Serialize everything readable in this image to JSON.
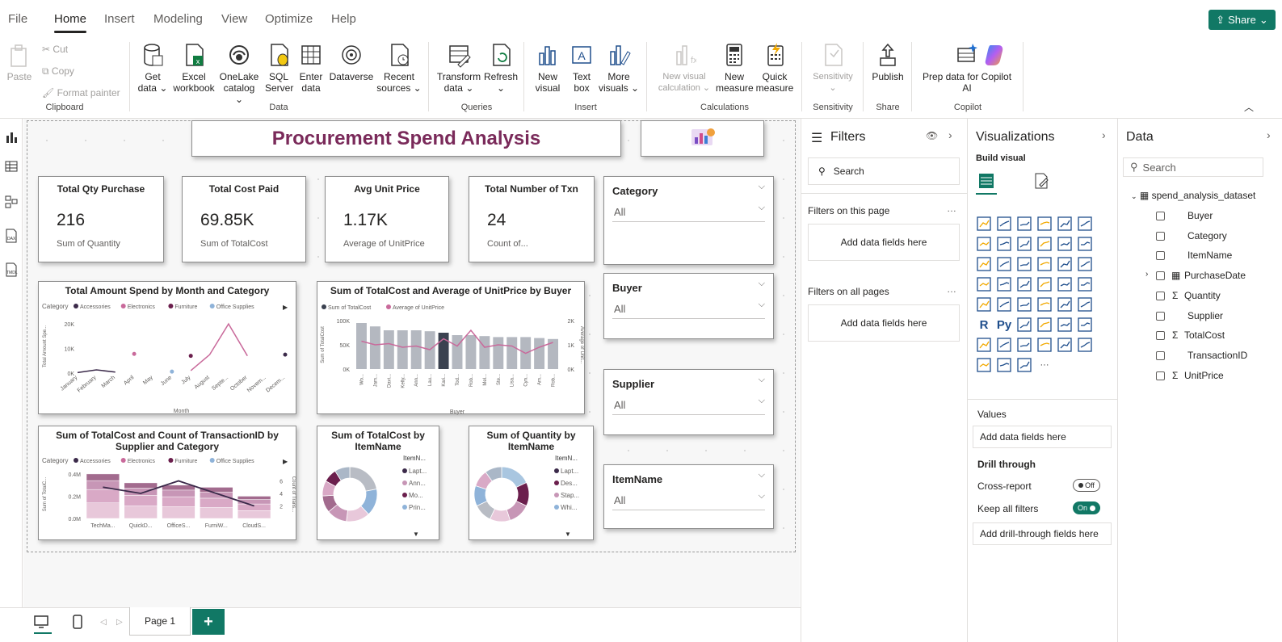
{
  "menu": {
    "file": "File",
    "home": "Home",
    "insert": "Insert",
    "modeling": "Modeling",
    "view": "View",
    "optimize": "Optimize",
    "help": "Help",
    "share": "Share"
  },
  "ribbon": {
    "paste": "Paste",
    "cut": "Cut",
    "copy": "Copy",
    "format_painter": "Format painter",
    "clipboard": "Clipboard",
    "get_data": [
      "Get",
      "data ⌄"
    ],
    "excel": [
      "Excel",
      "workbook"
    ],
    "onelake": [
      "OneLake",
      "catalog ⌄"
    ],
    "sql": [
      "SQL",
      "Server"
    ],
    "enter": [
      "Enter",
      "data"
    ],
    "dataverse": [
      "Dataverse"
    ],
    "recent": [
      "Recent",
      "sources ⌄"
    ],
    "data_group": "Data",
    "transform": [
      "Transform",
      "data ⌄"
    ],
    "refresh": [
      "Refresh",
      "⌄"
    ],
    "queries": "Queries",
    "new_visual": [
      "New",
      "visual"
    ],
    "text_box": [
      "Text",
      "box"
    ],
    "more_visuals": [
      "More",
      "visuals ⌄"
    ],
    "insert_group": "Insert",
    "new_visual_calc": [
      "New visual",
      "calculation ⌄"
    ],
    "new_measure": [
      "New",
      "measure"
    ],
    "quick_measure": [
      "Quick",
      "measure"
    ],
    "calculations": "Calculations",
    "sensitivity": [
      "Sensitivity",
      "⌄"
    ],
    "sensitivity_group": "Sensitivity",
    "publish": [
      "Publish"
    ],
    "share_group": "Share",
    "prep_data": [
      "Prep data for Copilot",
      "AI"
    ],
    "copilot": "Copilot"
  },
  "report": {
    "title": "Procurement Spend Analysis",
    "kpis": [
      {
        "title": "Total Qty Purchase",
        "value": "216",
        "sub": "Sum of Quantity"
      },
      {
        "title": "Total Cost Paid",
        "value": "69.85K",
        "sub": "Sum of TotalCost"
      },
      {
        "title": "Avg Unit Price",
        "value": "1.17K",
        "sub": "Average of UnitPrice"
      },
      {
        "title": "Total Number of Txn",
        "value": "24",
        "sub": "Count of..."
      }
    ],
    "slicers": [
      {
        "title": "Category",
        "value": "All"
      },
      {
        "title": "Buyer",
        "value": "All"
      },
      {
        "title": "Supplier",
        "value": "All"
      },
      {
        "title": "ItemName",
        "value": "All"
      }
    ]
  },
  "chart_data": [
    {
      "type": "line",
      "title": "Total Amount Spend by Month and Category",
      "legend_title": "Category",
      "xlabel": "Month",
      "ylabel": "Total Amount Spe...",
      "categories": [
        "January",
        "February",
        "March",
        "April",
        "May",
        "June",
        "July",
        "August",
        "Septe...",
        "October",
        "Novem...",
        "Decem..."
      ],
      "yticks": [
        "20K",
        "10K",
        "0K"
      ],
      "ylim": [
        0,
        22000
      ],
      "series": [
        {
          "name": "Accessories",
          "color": "#3b2a4a",
          "values": [
            200,
            1300,
            400,
            null,
            null,
            null,
            null,
            null,
            null,
            null,
            null,
            7500
          ]
        },
        {
          "name": "Electronics",
          "color": "#c96a9b",
          "values": [
            null,
            null,
            null,
            7800,
            null,
            null,
            1000,
            7500,
            20000,
            7000,
            null,
            null
          ]
        },
        {
          "name": "Furniture",
          "color": "#6b1f4d",
          "values": [
            null,
            null,
            null,
            null,
            null,
            null,
            7000,
            null,
            null,
            null,
            null,
            null
          ]
        },
        {
          "name": "Office Supplies",
          "color": "#8fb3d9",
          "values": [
            null,
            null,
            null,
            null,
            null,
            600,
            null,
            null,
            null,
            null,
            null,
            null
          ]
        }
      ]
    },
    {
      "type": "bar",
      "title": "Sum of TotalCost and Average of UnitPrice by Buyer",
      "legend": [
        "Sum of TotalCost",
        "Average of UnitPrice"
      ],
      "xlabel": "Buyer",
      "ylabel": "Sum of TotalCost",
      "y2label": "Average of Unit...",
      "categories": [
        "Wo...",
        "Jam...",
        "Davi...",
        "Kelly...",
        "Ann...",
        "Lau...",
        "Kari...",
        "Tod...",
        "Rob...",
        "Mel...",
        "Ste...",
        "Lisa...",
        "Cyn...",
        "Am...",
        "Rob..."
      ],
      "yticks": [
        "100K",
        "50K",
        "0K"
      ],
      "y2ticks": [
        "2K",
        "1K",
        "0K"
      ],
      "ylim": [
        0,
        100000
      ],
      "values": [
        95000,
        88000,
        80000,
        80000,
        80000,
        78000,
        75000,
        70000,
        70000,
        68000,
        66000,
        66000,
        66000,
        64000,
        62000
      ],
      "line_values": [
        1150,
        1000,
        1050,
        900,
        950,
        800,
        1250,
        950,
        1600,
        900,
        1000,
        950,
        650,
        900,
        1100
      ],
      "y2lim": [
        0,
        2000
      ],
      "highlight_index": 6
    },
    {
      "type": "bar",
      "title": "Sum of TotalCost and Count of TransactionID by Supplier and Category",
      "legend_title": "Category",
      "legend": [
        "Accessories",
        "Electronics",
        "Furniture",
        "Office Supplies"
      ],
      "categories": [
        "TechMa...",
        "QuickD...",
        "OfficeS...",
        "FurniW...",
        "CloudS..."
      ],
      "yticks": [
        "0.4M",
        "0.2M",
        "0.0M"
      ],
      "y2ticks": [
        "6",
        "4",
        "2"
      ],
      "ylabel": "Sum of TotalC...",
      "y2label": "Count of Trans...",
      "ylim": [
        0,
        0.45
      ],
      "values": [
        0.4,
        0.32,
        0.3,
        0.28,
        0.2
      ],
      "line_values": [
        5,
        4,
        6,
        4,
        2
      ],
      "y2lim": [
        0,
        8
      ]
    },
    {
      "type": "pie",
      "title": "Sum of TotalCost by ItemName",
      "legend_title": "ItemN...",
      "legend": [
        "Lapt...",
        "Ann...",
        "Mo...",
        "Prin..."
      ],
      "legend_colors": [
        "#3b2a4a",
        "#c796b6",
        "#6b1f4d",
        "#8fb3d9"
      ],
      "values": [
        22,
        16,
        14,
        12,
        10,
        9,
        8,
        9
      ],
      "colors": [
        "#b8bcc4",
        "#8fb3d9",
        "#e8c8da",
        "#c796b6",
        "#a26b8e",
        "#d9a9c6",
        "#6b1f4d",
        "#aab7c7"
      ]
    },
    {
      "type": "pie",
      "title": "Sum of Quantity by ItemName",
      "legend_title": "ItemN...",
      "legend": [
        "Lapt...",
        "Des...",
        "Stap...",
        "Whi..."
      ],
      "legend_colors": [
        "#3b2a4a",
        "#6b1f4d",
        "#c796b6",
        "#8fb3d9"
      ],
      "values": [
        18,
        14,
        13,
        12,
        11,
        12,
        10,
        10
      ],
      "colors": [
        "#a9c6e0",
        "#6b1f4d",
        "#c796b6",
        "#e8c8da",
        "#b8bcc4",
        "#8fb3d9",
        "#d9a9c6",
        "#aab7c7"
      ]
    }
  ],
  "filters": {
    "title": "Filters",
    "search": "Search",
    "this_page": "Filters on this page",
    "all_pages": "Filters on all pages",
    "add": "Add data fields here"
  },
  "viz": {
    "title": "Visualizations",
    "build": "Build visual",
    "values": "Values",
    "add": "Add data fields here",
    "drill": "Drill through",
    "cross": "Cross-report",
    "keep": "Keep all filters",
    "off": "Off",
    "on": "On",
    "add_drill": "Add drill-through fields here"
  },
  "data": {
    "title": "Data",
    "search": "Search",
    "dataset": "spend_analysis_dataset",
    "fields": [
      {
        "name": "Buyer",
        "sigma": false
      },
      {
        "name": "Category",
        "sigma": false
      },
      {
        "name": "ItemName",
        "sigma": false
      },
      {
        "name": "PurchaseDate",
        "sigma": false,
        "table": true
      },
      {
        "name": "Quantity",
        "sigma": true
      },
      {
        "name": "Supplier",
        "sigma": false
      },
      {
        "name": "TotalCost",
        "sigma": true
      },
      {
        "name": "TransactionID",
        "sigma": false
      },
      {
        "name": "UnitPrice",
        "sigma": true
      }
    ]
  },
  "page": {
    "tab": "Page 1"
  }
}
